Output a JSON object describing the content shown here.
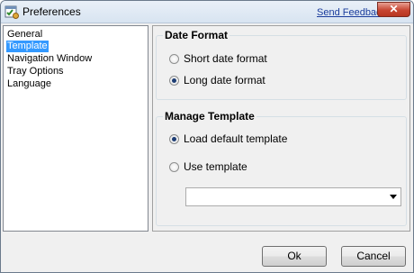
{
  "window": {
    "title": "Preferences",
    "feedback_link": "Send Feedback",
    "close_label": "✕"
  },
  "nav": {
    "items": [
      "General",
      "Template",
      "Navigation Window",
      "Tray Options",
      "Language"
    ],
    "selected_index": 1
  },
  "date_format": {
    "title": "Date Format",
    "options": [
      "Short date format",
      "Long date format"
    ],
    "selected": "Long date format"
  },
  "manage_template": {
    "title": "Manage Template",
    "options": [
      "Load default template",
      "Use template"
    ],
    "selected": "Load default template",
    "template_select_value": ""
  },
  "footer": {
    "ok_label": "Ok",
    "cancel_label": "Cancel"
  },
  "colors": {
    "selection": "#3399ff",
    "close_button": "#c74632",
    "link": "#1a3c9c"
  }
}
